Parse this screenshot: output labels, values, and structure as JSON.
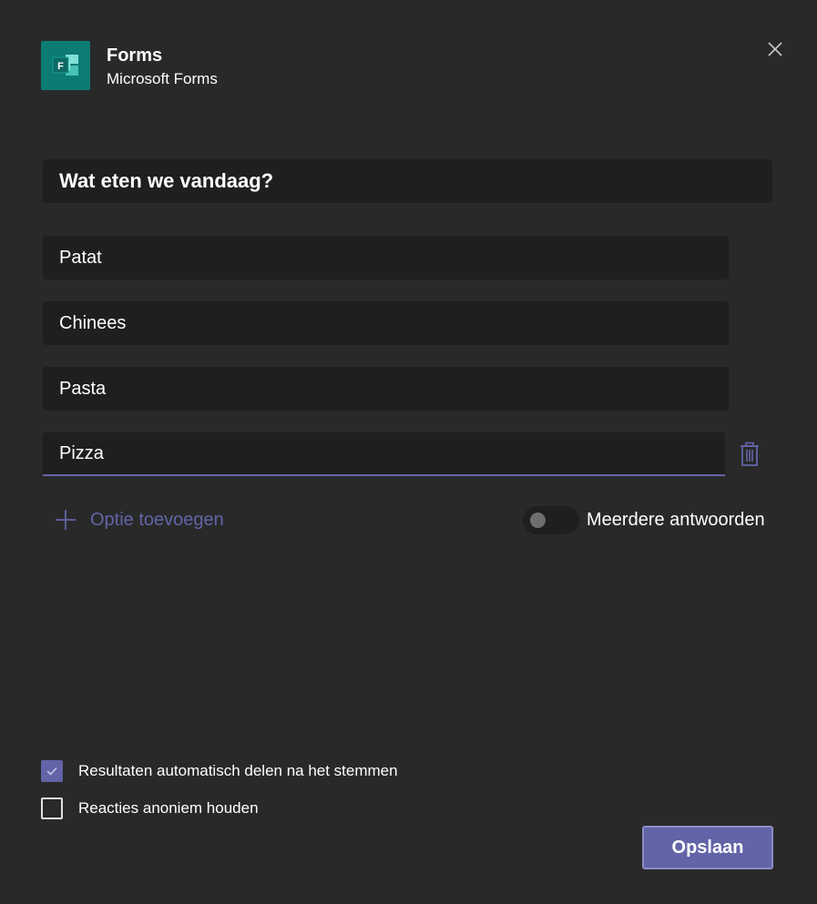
{
  "header": {
    "app_name": "Forms",
    "app_subtitle": "Microsoft Forms",
    "icon_letter": "F",
    "icon_color": "#0b7b74"
  },
  "form": {
    "question": "Wat eten we vandaag?",
    "options": [
      "Patat",
      "Chinees",
      "Pasta",
      "Pizza"
    ],
    "add_option_label": "Optie toevoegen",
    "multiple_answers_label": "Meerdere antwoorden",
    "multiple_answers_enabled": false
  },
  "settings": {
    "share_results_label": "Resultaten automatisch delen na het stemmen",
    "share_results_checked": true,
    "anonymous_label": "Reacties anoniem houden",
    "anonymous_checked": false
  },
  "footer": {
    "save_label": "Opslaan"
  },
  "colors": {
    "background": "#292929",
    "field": "#1f1f1f",
    "accent": "#6264a7"
  }
}
